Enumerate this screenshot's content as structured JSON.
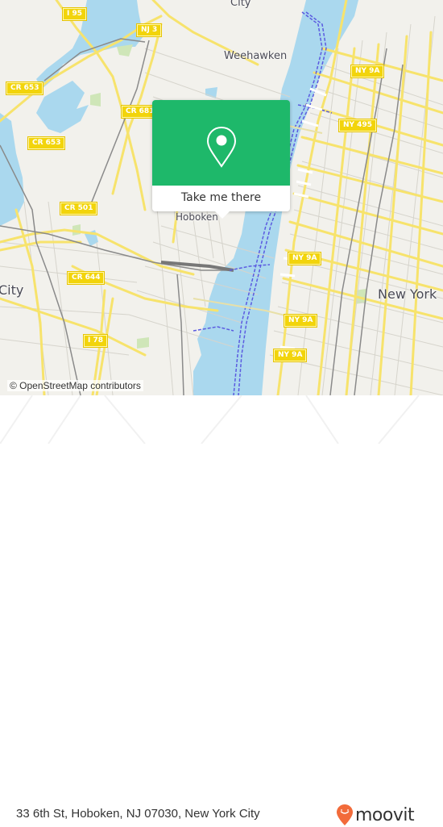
{
  "map": {
    "colors": {
      "land": "#f2f1ec",
      "water": "#aad8ee",
      "major_road": "#f7e36c",
      "minor_road": "#d6d4cc",
      "rail": "#8a8a8a",
      "park": "#cfe6b8",
      "ferry": "#5b5be0"
    },
    "place_labels": [
      {
        "name": "City",
        "id": "city-top"
      },
      {
        "name": "Weehawken",
        "id": "weehawken"
      },
      {
        "name": "Hoboken",
        "id": "hoboken"
      },
      {
        "name": "New York",
        "id": "new-york"
      },
      {
        "name": "City",
        "id": "city-left"
      }
    ],
    "route_shields": [
      {
        "label": "I 95"
      },
      {
        "label": "NJ 3"
      },
      {
        "label": "CR 653"
      },
      {
        "label": "CR 681"
      },
      {
        "label": "CR 653"
      },
      {
        "label": "CR 501"
      },
      {
        "label": "CR 644"
      },
      {
        "label": "I 78"
      },
      {
        "label": "NY 9A"
      },
      {
        "label": "NY 495"
      },
      {
        "label": "NY 9A"
      },
      {
        "label": "NY 9A"
      },
      {
        "label": "NY 9A"
      }
    ],
    "attribution": "© OpenStreetMap contributors"
  },
  "popup": {
    "icon": "map-pin-icon",
    "button_label": "Take me there",
    "color": "#1eb86a"
  },
  "footer": {
    "address": "33 6th St, Hoboken, NJ 07030, New York City",
    "brand": "moovit",
    "brand_icon": "moovit-pin-logo-icon",
    "brand_color": "#f26b3a"
  }
}
